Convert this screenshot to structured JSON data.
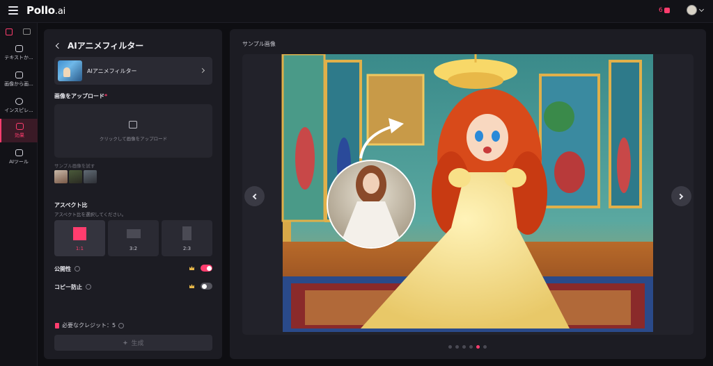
{
  "app": {
    "brand": "Pollo",
    "brand_suffix": ".ai",
    "credits_count": "6"
  },
  "nav": {
    "items": [
      {
        "label": "テキストか..."
      },
      {
        "label": "画像から画..."
      },
      {
        "label": "インスピレ..."
      },
      {
        "label": "効果"
      },
      {
        "label": "AIツール"
      }
    ],
    "active_index": 3
  },
  "panel": {
    "title": "AIアニメフィルター",
    "filter_name": "AIアニメフィルター",
    "upload_label": "画像をアップロード",
    "upload_required_mark": "*",
    "upload_hint": "クリックして画像をアップロード",
    "samples_label": "サンプル画像を試す",
    "aspect_title": "アスペクト比",
    "aspect_subtitle": "アスペクト比を選択してください。",
    "aspect_options": [
      {
        "label": "1:1",
        "selected": true
      },
      {
        "label": "3:2",
        "selected": false
      },
      {
        "label": "2:3",
        "selected": false
      }
    ],
    "toggles": [
      {
        "label": "公開性",
        "on": true
      },
      {
        "label": "コピー防止",
        "on": false
      }
    ],
    "credits_needed": "必要なクレジット：5",
    "generate_label": "生成"
  },
  "preview": {
    "title": "サンプル画像",
    "dots_count": 6,
    "active_dot": 4
  },
  "colors": {
    "accent": "#ff3d6e",
    "panel_bg": "#1c1c23",
    "page_bg": "#0e0e12"
  }
}
